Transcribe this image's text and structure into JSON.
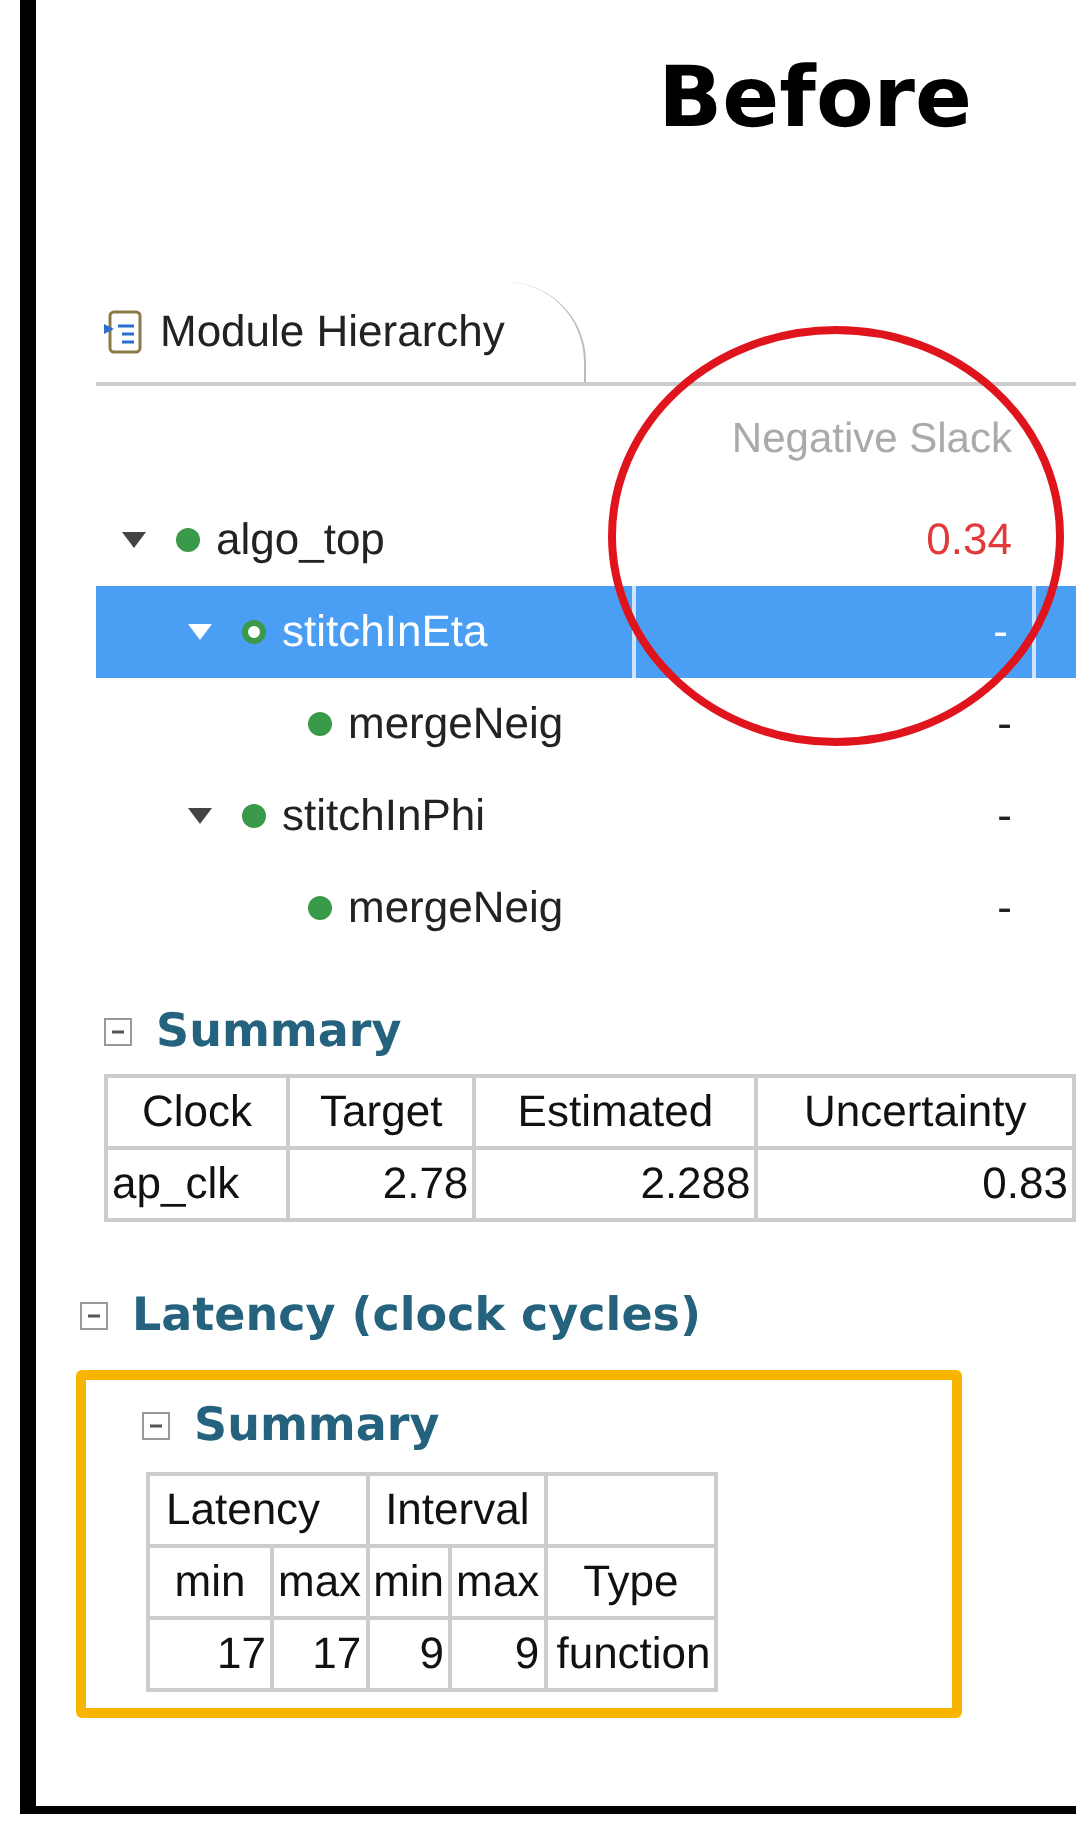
{
  "title": "Before",
  "tab": {
    "label": "Module Hierarchy",
    "selected": true
  },
  "tree": {
    "column": "Negative Slack",
    "rows": [
      {
        "name": "algo_top",
        "slack": "0.34",
        "violation": true,
        "selected": false,
        "expanded": true,
        "children": [
          {
            "name": "stitchInEta",
            "slack": "-",
            "violation": false,
            "selected": true,
            "expanded": true,
            "children": [
              {
                "name": "mergeNeig",
                "slack": "-",
                "violation": false,
                "selected": false
              }
            ]
          },
          {
            "name": "stitchInPhi",
            "slack": "-",
            "violation": false,
            "selected": false,
            "expanded": true,
            "children": [
              {
                "name": "mergeNeig",
                "slack": "-",
                "violation": false,
                "selected": false
              }
            ]
          }
        ]
      }
    ]
  },
  "timing_summary": {
    "title": "Summary",
    "expanded": true,
    "columns": [
      "Clock",
      "Target",
      "Estimated",
      "Uncertainty"
    ],
    "rows": [
      [
        "ap_clk",
        "2.78",
        "2.288",
        "0.83"
      ]
    ]
  },
  "latency": {
    "title": "Latency (clock cycles)",
    "expanded": true,
    "summary": {
      "title": "Summary",
      "expanded": true,
      "header_groups": [
        {
          "label": "Latency",
          "columns": [
            "min",
            "max"
          ]
        },
        {
          "label": "Interval",
          "columns": [
            "min",
            "max"
          ]
        }
      ],
      "extra_columns": [
        "Type"
      ],
      "rows": [
        [
          "17",
          "17",
          "9",
          "9",
          "function"
        ]
      ]
    }
  },
  "annotations": [
    {
      "kind": "circle",
      "color": "#e0141c"
    },
    {
      "kind": "box",
      "color": "#f7b500"
    }
  ]
}
